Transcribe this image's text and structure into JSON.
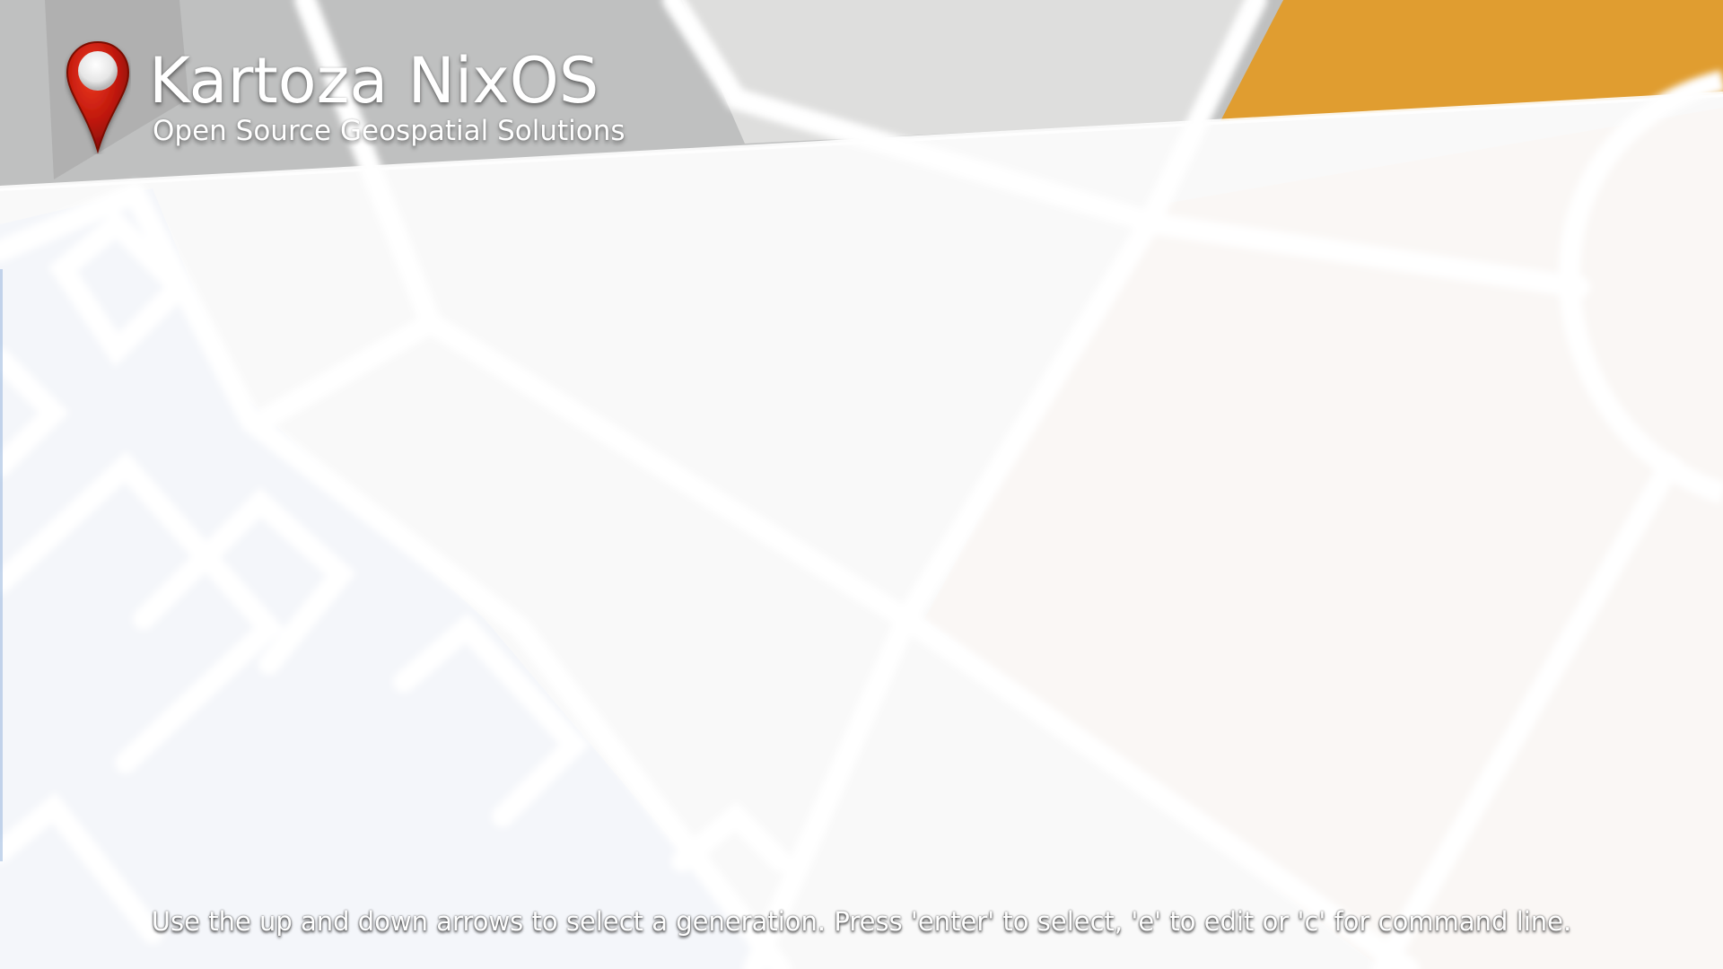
{
  "brand": {
    "title": "Kartoza NixOS",
    "subtitle": "Open Source Geospatial Solutions",
    "logo_icon": "map-pin-icon",
    "pin_color": "#c0180c",
    "accent_orange": "#e09d30"
  },
  "boot_menu": {
    "entries": []
  },
  "footer": {
    "help_text": "Use the up and down arrows to select a generation. Press 'enter' to select, 'e' to edit or 'c' for command line."
  }
}
